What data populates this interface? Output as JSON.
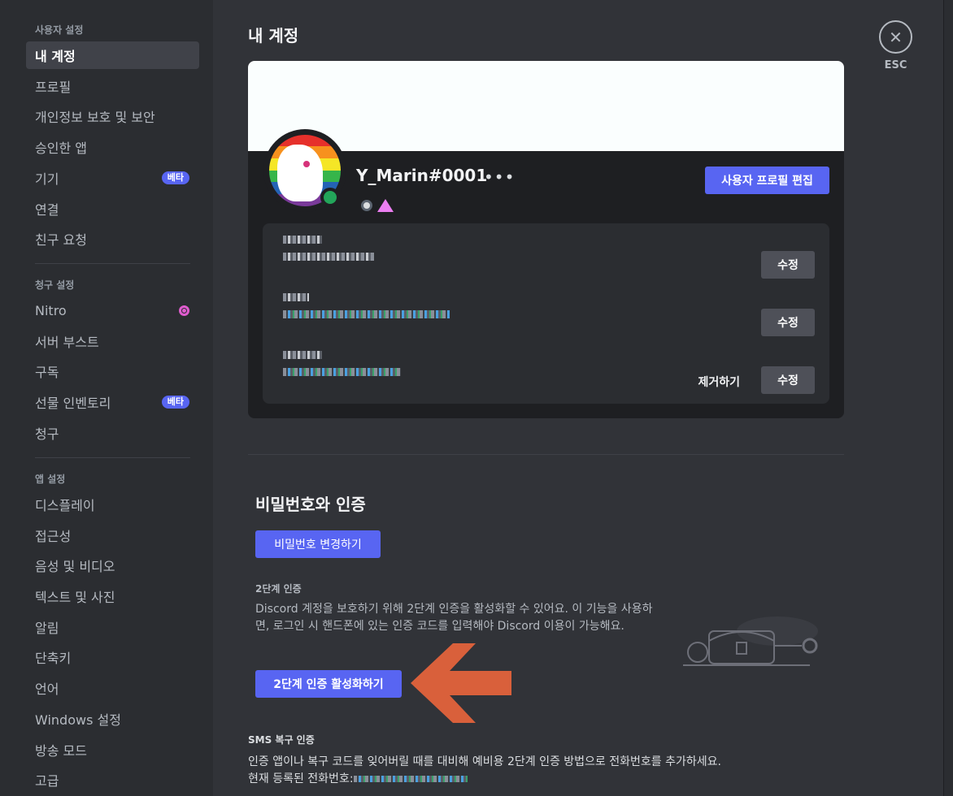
{
  "sidebar": {
    "user_settings_header": "사용자 설정",
    "user_items": [
      {
        "label": "내 계정"
      },
      {
        "label": "프로필"
      },
      {
        "label": "개인정보 보호 및 보안"
      },
      {
        "label": "승인한 앱"
      },
      {
        "label": "기기",
        "badge": "베타"
      },
      {
        "label": "연결"
      },
      {
        "label": "친구 요청"
      }
    ],
    "billing_header": "청구 설정",
    "billing_items": [
      {
        "label": "Nitro"
      },
      {
        "label": "서버 부스트"
      },
      {
        "label": "구독"
      },
      {
        "label": "선물 인벤토리",
        "badge": "베타"
      },
      {
        "label": "청구"
      }
    ],
    "app_header": "앱 설정",
    "app_items": [
      {
        "label": "디스플레이"
      },
      {
        "label": "접근성"
      },
      {
        "label": "음성 및 비디오"
      },
      {
        "label": "텍스트 및 사진"
      },
      {
        "label": "알림"
      },
      {
        "label": "단축키"
      },
      {
        "label": "언어"
      },
      {
        "label": "Windows 설정"
      },
      {
        "label": "방송 모드"
      },
      {
        "label": "고급"
      }
    ]
  },
  "header": {
    "title": "내 계정",
    "close_label": "ESC",
    "close_glyph": "✕"
  },
  "profile": {
    "username": "Y_Marin#0001",
    "more_glyph": "•••",
    "edit_button": "사용자 프로필 편집",
    "banner_color": "#fafefe",
    "fields": [
      {
        "edit_label": "수정"
      },
      {
        "edit_label": "수정"
      },
      {
        "remove_label": "제거하기",
        "edit_label": "수정"
      }
    ]
  },
  "password_auth": {
    "title": "비밀번호와 인증",
    "change_password_button": "비밀번호 변경하기",
    "two_factor_title": "2단계 인증",
    "two_factor_desc": "Discord 계정을 보호하기 위해 2단계 인증을 활성화할 수 있어요. 이 기능을 사용하면, 로그인 시 핸드폰에 있는 인증 코드를 입력해야 Discord 이용이 가능해요.",
    "enable_2fa_button": "2단계 인증 활성화하기"
  },
  "sms": {
    "title": "SMS 복구 인증",
    "desc_line1": "인증 앱이나 복구 코드를 잊어버릴 때를 대비해 예비용 2단계 인증 방법으로 전화번호를 추가하세요.",
    "desc_line2": "현재 등록된 전화번호:"
  },
  "colors": {
    "accent": "#5865f2",
    "arrow": "#d9603b",
    "online": "#23a55a"
  }
}
